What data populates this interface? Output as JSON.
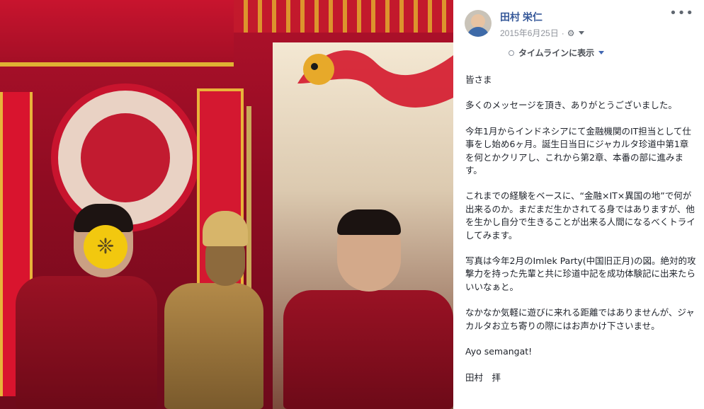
{
  "post": {
    "author": "田村 栄仁",
    "date": "2015年6月25日",
    "date_suffix": "·",
    "privacy_icon": "gear-icon",
    "more_label": "•••",
    "timeline_label": "タイムラインに表示",
    "body": [
      "皆さま",
      "多くのメッセージを頂き、ありがとうございました。",
      "今年1月からインドネシアにて金融機関のIT担当として仕事をし始め6ヶ月。誕生日当日にジャカルタ珍道中第1章を何とかクリアし、これから第2章、本番の部に進みます。",
      "これまでの経験をベースに、“金融×IT×異国の地”で何が出来るのか。まだまだ生かされてる身ではありますが、他を生かし自分で生きることが出来る人間になるべくトライしてみます。",
      "写真は今年2月のImlek Party(中国旧正月)の図。絶対的攻撃力を持った先輩と共に珍道中記を成功体験記に出来たらいいなぁと。",
      "なかなか気軽に遊びに来れる距離ではありませんが、ジャカルタお立ち寄りの際にはお声かけ下さいませ。",
      "Ayo semangat!",
      "田村　拝"
    ]
  },
  "photo": {
    "sticker_glyph": "❈"
  },
  "colors": {
    "link": "#365899",
    "meta": "#90949c",
    "text": "#1d2129"
  }
}
